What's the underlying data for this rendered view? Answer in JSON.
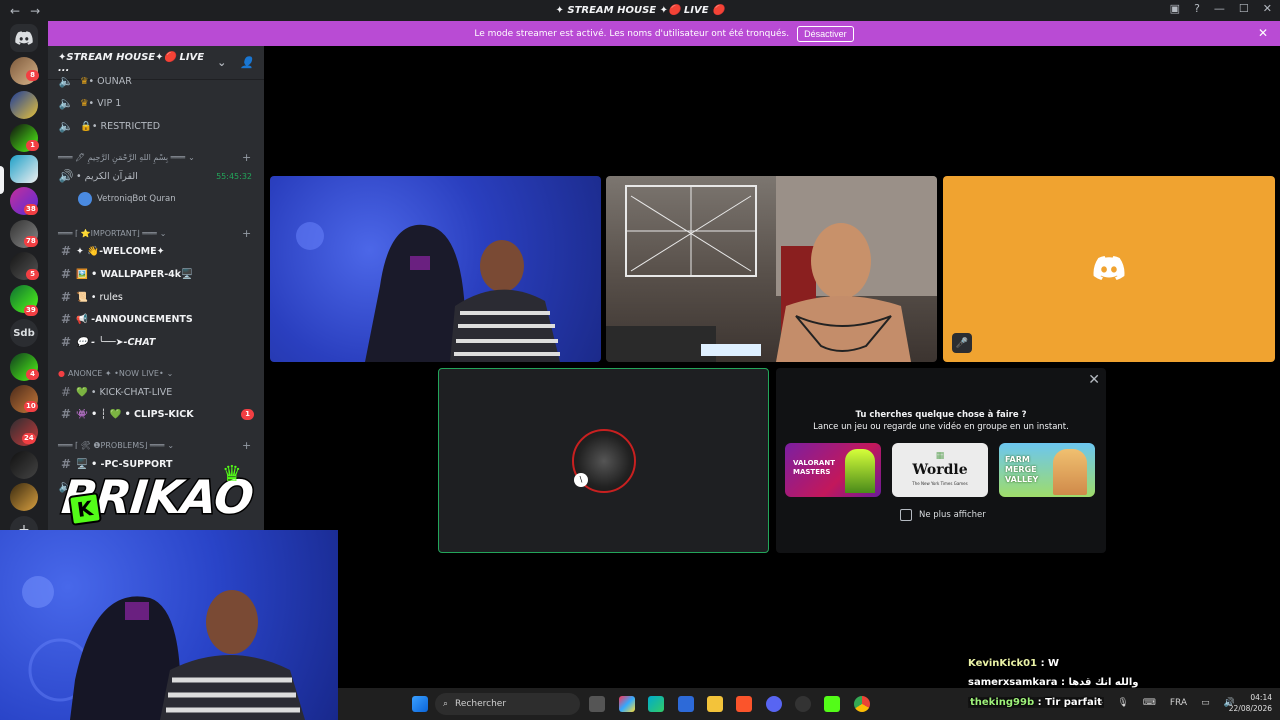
{
  "window": {
    "title": "✦ STREAM HOUSE ✦🔴 LIVE 🔴",
    "back_icon": "←",
    "forward_icon": "→"
  },
  "banner": {
    "text": "Le mode streamer est activé. Les noms d'utilisateur ont été tronqués.",
    "button": "Désactiver"
  },
  "rail": {
    "text_server": "Sdb",
    "badges": [
      "8",
      "1",
      "38",
      "78",
      "5",
      "39",
      "4",
      "10",
      "24"
    ]
  },
  "sidebar": {
    "server_name": "✦STREAM HOUSE✦🔴 LIVE ...",
    "channels_top": [
      {
        "label": "• OUNAR",
        "icon": "🔈"
      },
      {
        "label": "• VIP 1",
        "icon": "🔈"
      },
      {
        "label": "• RESTRICTED",
        "icon": "🔈"
      }
    ],
    "cat1": {
      "label": "═══ 🖊 بِسْمِ اللهِ الرَّحْمَنِ الرَّحِيمِ ═══"
    },
    "voice_quran": {
      "label": "• القرآن الكريم",
      "timer": "55:45:32",
      "member": "VetroniqBot Quran"
    },
    "cat2": {
      "label": "═══ ⌈ ⭐IMPORTANT⌋ ═══"
    },
    "channels_important": [
      {
        "label": "✦ 👋-WELCOME✦"
      },
      {
        "label": "🖼️ • WALLPAPER-4k🖥️"
      },
      {
        "label": "📜 • rules"
      },
      {
        "label": "📢 -ANNOUNCEMENTS"
      },
      {
        "label": "💬 - ╰──➤-CHAT"
      }
    ],
    "cat3": {
      "label": "ANONCE ✦ •NOW LIVE•"
    },
    "channels_live": [
      {
        "label": "💚 • KICK-CHAT-LIVE"
      },
      {
        "label": "👾 • ┆ 💚 • CLIPS-KICK",
        "badge": "1"
      }
    ],
    "cat4": {
      "label": "═══ ⌈ 🛠 ❶PROBLEMS⌋ ═══"
    },
    "channels_problems": [
      {
        "label": "🖥️ • -PC-SUPPORT"
      }
    ]
  },
  "activities": {
    "title_line1": "Tu cherches quelque chose à faire ?",
    "title_line2": "Lance un jeu ou regarde une vidéo en groupe en un instant.",
    "cards": [
      {
        "name": "VALORANT MASTERS",
        "color": "#9b2fae"
      },
      {
        "name": "Wordle",
        "sub": "The New York Times Games",
        "color": "#e9e9e9"
      },
      {
        "name": "FARM MERGE VALLEY",
        "color": "#59b7e8"
      }
    ],
    "checkbox_label": "Ne plus afficher"
  },
  "overlay": {
    "logo": "BRIKAO",
    "logo_mark": "K"
  },
  "chat": [
    {
      "user": "KevinKick01",
      "msg": ": W"
    },
    {
      "user": "samerxsamkara",
      "msg": ": والله انك قدها"
    },
    {
      "user": "theking99b",
      "msg": ": Tir parfait"
    }
  ],
  "taskbar": {
    "search_placeholder": "Rechercher",
    "lang": "FRA",
    "time": "04:14",
    "date": "22/08/2026"
  },
  "colors": {
    "banner": "#b94bd4",
    "discord_yellow": "#f0a330",
    "speaking_green": "#23a55a",
    "kick_green": "#53fc18"
  }
}
